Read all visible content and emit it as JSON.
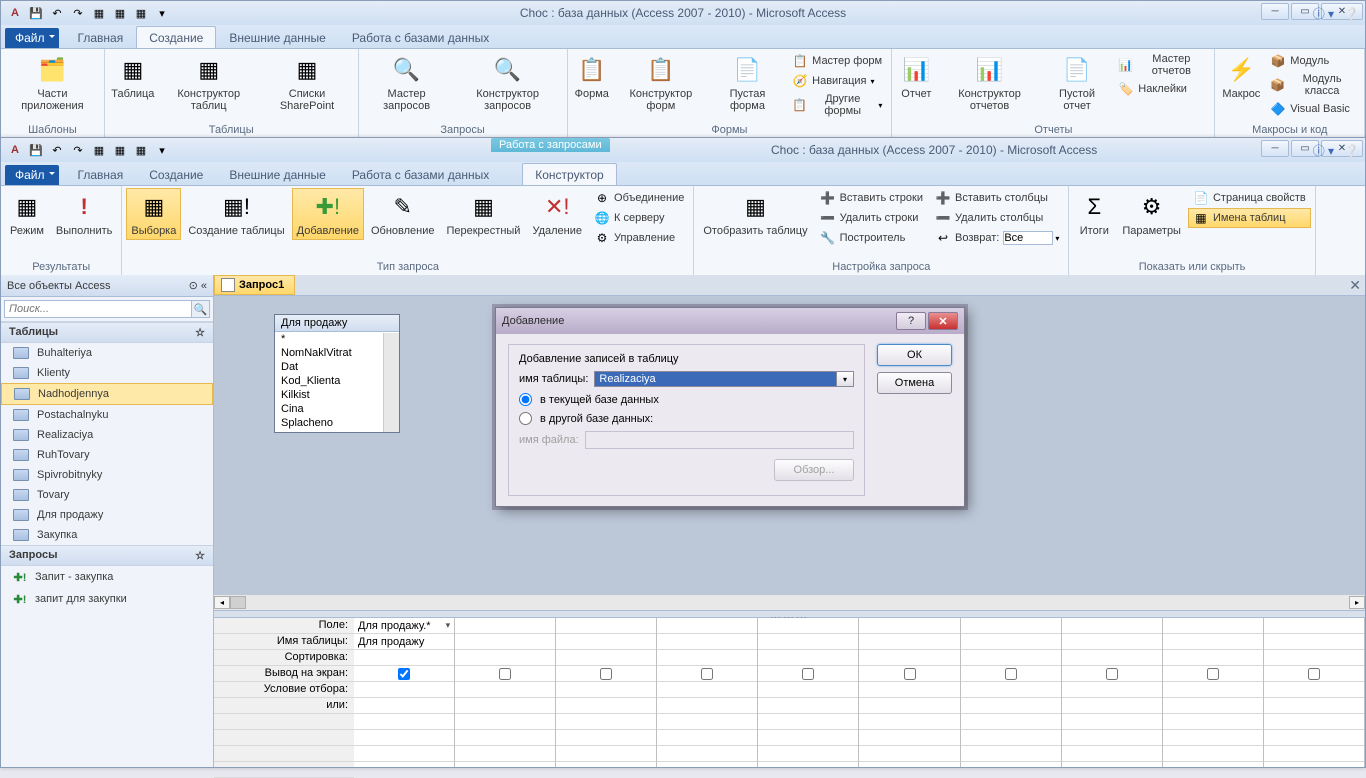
{
  "win1": {
    "title": "Choc : база данных (Access 2007 - 2010)  -  Microsoft Access",
    "tabs": {
      "file": "Файл",
      "home": "Главная",
      "create": "Создание",
      "external": "Внешние данные",
      "dbtools": "Работа с базами данных"
    },
    "groups": {
      "templates": {
        "label": "Шаблоны",
        "appParts": "Части\nприложения"
      },
      "tables": {
        "label": "Таблицы",
        "table": "Таблица",
        "tdesign": "Конструктор\nтаблиц",
        "sharepoint": "Списки\nSharePoint"
      },
      "queries": {
        "label": "Запросы",
        "qwizard": "Мастер\nзапросов",
        "qdesign": "Конструктор\nзапросов"
      },
      "forms": {
        "label": "Формы",
        "form": "Форма",
        "fdesign": "Конструктор\nформ",
        "blank": "Пустая\nформа",
        "fwizard": "Мастер форм",
        "nav": "Навигация",
        "other": "Другие формы"
      },
      "reports": {
        "label": "Отчеты",
        "report": "Отчет",
        "rdesign": "Конструктор\nотчетов",
        "blank": "Пустой\nотчет",
        "rwizard": "Мастер отчетов",
        "labels": "Наклейки"
      },
      "macros": {
        "label": "Макросы и код",
        "macro": "Макрос",
        "module": "Модуль",
        "classmod": "Модуль класса",
        "vb": "Visual Basic"
      }
    }
  },
  "win2": {
    "title": "Choc : база данных (Access 2007 - 2010)  -  Microsoft Access",
    "context": {
      "group": "Работа с запросами",
      "tab": "Конструктор"
    },
    "tabs": {
      "file": "Файл",
      "home": "Главная",
      "create": "Создание",
      "external": "Внешние данные",
      "dbtools": "Работа с базами данных"
    },
    "groups": {
      "results": {
        "label": "Результаты",
        "view": "Режим",
        "run": "Выполнить"
      },
      "qtype": {
        "label": "Тип запроса",
        "select": "Выборка",
        "maketable": "Создание\nтаблицы",
        "append": "Добавление",
        "update": "Обновление",
        "crosstab": "Перекрестный",
        "delete": "Удаление",
        "union": "Объединение",
        "passthru": "К серверу",
        "datadef": "Управление"
      },
      "setup": {
        "label": "Настройка запроса",
        "showtable": "Отобразить\nтаблицу",
        "insrows": "Вставить строки",
        "delrows": "Удалить строки",
        "builder": "Построитель",
        "inscols": "Вставить столбцы",
        "delcols": "Удалить столбцы",
        "return": "Возврат:",
        "returnval": "Все"
      },
      "showhide": {
        "label": "Показать или скрыть",
        "totals": "Итоги",
        "params": "Параметры",
        "propsheet": "Страница свойств",
        "tablenames": "Имена таблиц"
      }
    }
  },
  "nav": {
    "title": "Все объекты Access",
    "search": "Поиск...",
    "tables": {
      "label": "Таблицы",
      "items": [
        "Buhalteriya",
        "Klienty",
        "Nadhodjennya",
        "Postachalnyku",
        "Realizaciya",
        "RuhTovary",
        "Spivrobitnyky",
        "Tovary",
        "Для продажу",
        "Закупка"
      ]
    },
    "queries": {
      "label": "Запросы",
      "items": [
        "Запит - закупка",
        "запит для закупки"
      ]
    }
  },
  "doc": {
    "tab": "Запрос1"
  },
  "tablebox": {
    "title": "Для продажу",
    "fields": [
      "*",
      "NomNaklVitrat",
      "Dat",
      "Kod_Klienta",
      "Kilkist",
      "Cina",
      "Splacheno"
    ]
  },
  "grid": {
    "labels": [
      "Поле:",
      "Имя таблицы:",
      "Сортировка:",
      "Вывод на экран:",
      "Условие отбора:",
      "или:"
    ],
    "col1": {
      "field": "Для продажу.*",
      "table": "Для продажу"
    }
  },
  "dialog": {
    "title": "Добавление",
    "group": "Добавление записей в таблицу",
    "tablename_lbl": "имя таблицы:",
    "tablename_val": "Realizaciya",
    "opt_current": "в текущей базе данных",
    "opt_other": "в другой базе данных:",
    "filename_lbl": "имя файла:",
    "browse": "Обзор...",
    "ok": "ОК",
    "cancel": "Отмена"
  }
}
